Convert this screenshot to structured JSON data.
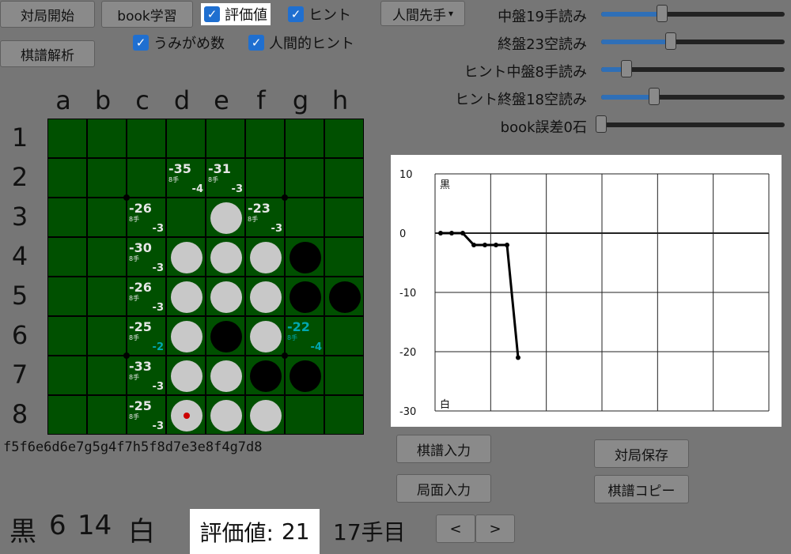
{
  "toolbar": {
    "start": "対局開始",
    "book": "book学習",
    "analyze": "棋譜解析",
    "player_select": "人間先手",
    "player_arrow": "▾"
  },
  "checks": {
    "eval": {
      "label": "評価値",
      "checked": true
    },
    "hint": {
      "label": "ヒント",
      "checked": true
    },
    "umigame": {
      "label": "うみがめ数",
      "checked": true
    },
    "human_hint": {
      "label": "人間的ヒント",
      "checked": true
    },
    "mark": "✓"
  },
  "sliders": [
    {
      "label": "中盤19手読み",
      "value": 0.33
    },
    {
      "label": "終盤23空読み",
      "value": 0.38
    },
    {
      "label": "ヒント中盤8手読み",
      "value": 0.14
    },
    {
      "label": "ヒント終盤18空読み",
      "value": 0.29
    },
    {
      "label": "book誤差0石",
      "value": 0.0
    }
  ],
  "board": {
    "columns": [
      "a",
      "b",
      "c",
      "d",
      "e",
      "f",
      "g",
      "h"
    ],
    "rows": [
      "1",
      "2",
      "3",
      "4",
      "5",
      "6",
      "7",
      "8"
    ],
    "discs": [
      {
        "r": 2,
        "c": 4,
        "color": "white"
      },
      {
        "r": 3,
        "c": 3,
        "color": "white"
      },
      {
        "r": 3,
        "c": 4,
        "color": "white"
      },
      {
        "r": 3,
        "c": 5,
        "color": "white"
      },
      {
        "r": 3,
        "c": 6,
        "color": "black"
      },
      {
        "r": 4,
        "c": 3,
        "color": "white"
      },
      {
        "r": 4,
        "c": 4,
        "color": "white"
      },
      {
        "r": 4,
        "c": 5,
        "color": "white"
      },
      {
        "r": 4,
        "c": 6,
        "color": "black"
      },
      {
        "r": 4,
        "c": 7,
        "color": "black"
      },
      {
        "r": 5,
        "c": 3,
        "color": "white"
      },
      {
        "r": 5,
        "c": 4,
        "color": "black"
      },
      {
        "r": 5,
        "c": 5,
        "color": "white"
      },
      {
        "r": 6,
        "c": 3,
        "color": "white"
      },
      {
        "r": 6,
        "c": 4,
        "color": "white"
      },
      {
        "r": 6,
        "c": 5,
        "color": "black"
      },
      {
        "r": 6,
        "c": 6,
        "color": "black"
      },
      {
        "r": 7,
        "c": 3,
        "color": "white",
        "last": true
      },
      {
        "r": 7,
        "c": 4,
        "color": "white"
      },
      {
        "r": 7,
        "c": 5,
        "color": "white"
      }
    ],
    "hints": [
      {
        "r": 1,
        "c": 3,
        "main": "-35",
        "depth": "8手",
        "sub": "-4"
      },
      {
        "r": 1,
        "c": 4,
        "main": "-31",
        "depth": "8手",
        "sub": "-3"
      },
      {
        "r": 2,
        "c": 2,
        "main": "-26",
        "depth": "8手",
        "sub": "-3"
      },
      {
        "r": 2,
        "c": 5,
        "main": "-23",
        "depth": "8手",
        "sub": "-3"
      },
      {
        "r": 3,
        "c": 2,
        "main": "-30",
        "depth": "8手",
        "sub": "-3"
      },
      {
        "r": 4,
        "c": 2,
        "main": "-26",
        "depth": "8手",
        "sub": "-3"
      },
      {
        "r": 5,
        "c": 2,
        "main": "-25",
        "depth": "8手",
        "sub": "-2",
        "sub_best": true
      },
      {
        "r": 5,
        "c": 6,
        "main": "-22",
        "depth": "8手",
        "sub": "-4",
        "best": true
      },
      {
        "r": 6,
        "c": 2,
        "main": "-33",
        "depth": "8手",
        "sub": "-3"
      },
      {
        "r": 7,
        "c": 2,
        "main": "-25",
        "depth": "8手",
        "sub": "-3"
      }
    ]
  },
  "record": "f5f6e6d6e7g5g4f7h5f8d7e3e8f4g7d8",
  "graph": {
    "black_label": "黒",
    "white_label": "白",
    "y_ticks": [
      "10",
      "0",
      "-10",
      "-20",
      "-30"
    ],
    "evals": [
      0,
      0,
      0,
      -2,
      -2,
      -2,
      -2,
      -21
    ]
  },
  "buttons": {
    "kifu_input": "棋譜入力",
    "board_input": "局面入力",
    "save_game": "対局保存",
    "copy_kifu": "棋譜コピー",
    "prev": "<",
    "next": ">"
  },
  "status": {
    "black_label": "黒",
    "black_count": "6",
    "white_count": "14",
    "white_label": "白",
    "eval_label": "評価値:",
    "eval_value": "21",
    "move_number": "17手目"
  },
  "colors": {
    "background": "#767676",
    "board_green": "#005000",
    "accent_blue": "#1f6fd0",
    "best_hint": "#00a8b0",
    "last_move": "#cc0000"
  }
}
